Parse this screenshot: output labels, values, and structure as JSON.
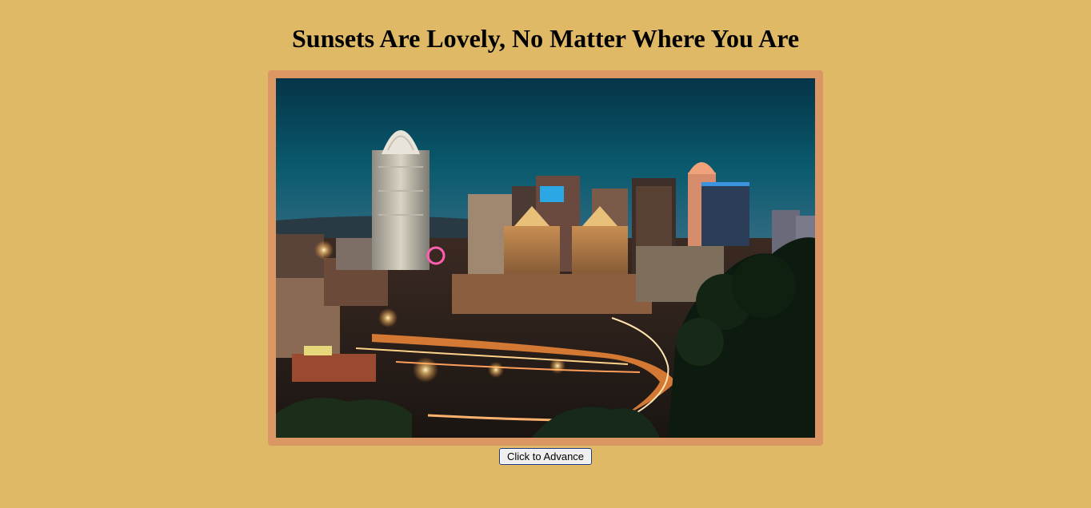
{
  "page": {
    "title": "Sunsets Are Lovely, No Matter Where You Are",
    "background_color": "#dfb966"
  },
  "slideshow": {
    "frame_color": "#da9663",
    "current_image": {
      "subject": "city skyline at dusk with illuminated skyscrapers and light-trailed highway",
      "sky_colors": [
        "#063a4e",
        "#0b6478",
        "#6a6f95"
      ]
    }
  },
  "controls": {
    "advance_label": "Click to Advance"
  }
}
